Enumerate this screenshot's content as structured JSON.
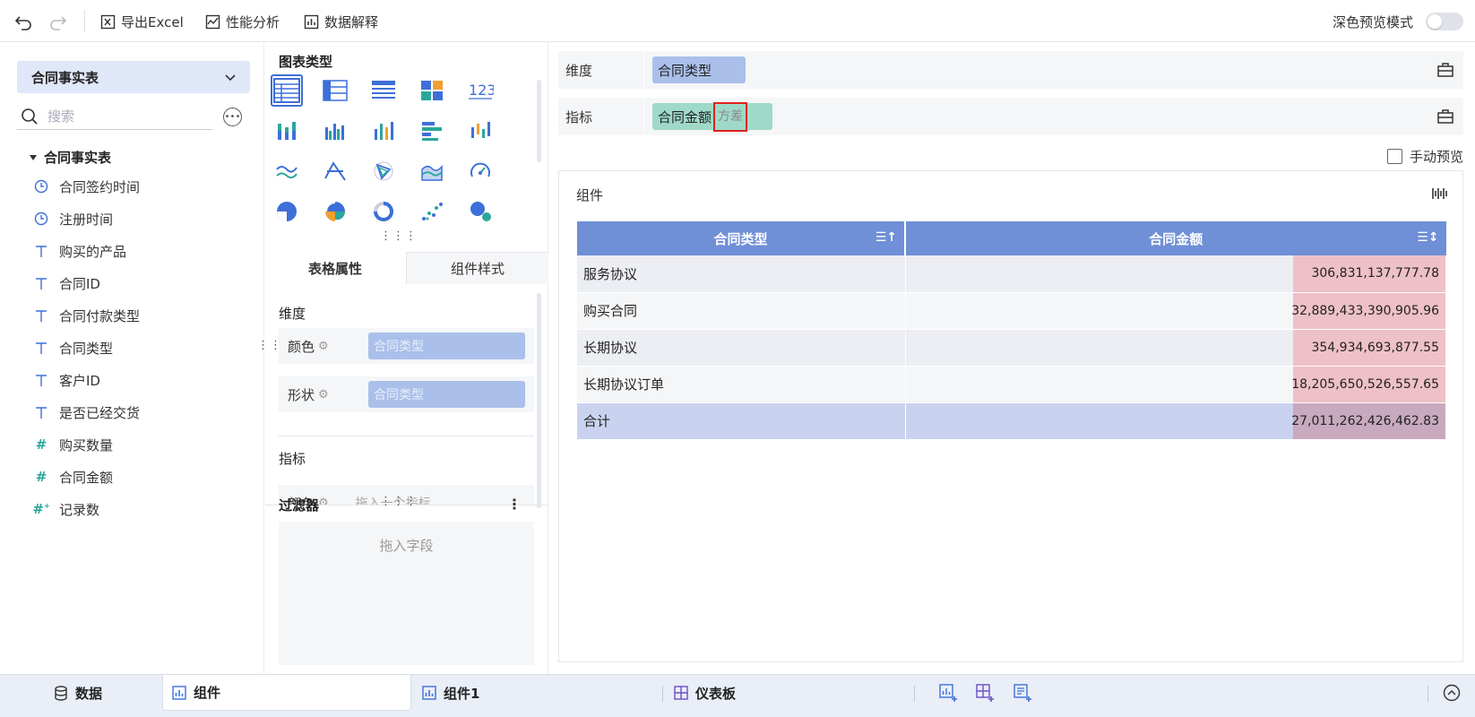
{
  "toolbar": {
    "undo": "undo",
    "redo": "redo",
    "export_excel": "导出Excel",
    "perf_analysis": "性能分析",
    "data_explain": "数据解释",
    "dark_preview": "深色预览模式",
    "dark_preview_on": false
  },
  "left": {
    "dataset": "合同事实表",
    "search_placeholder": "搜索",
    "tree_root": "合同事实表",
    "fields": [
      {
        "type": "time",
        "label": "合同签约时间"
      },
      {
        "type": "time",
        "label": "注册时间"
      },
      {
        "type": "text",
        "label": "购买的产品"
      },
      {
        "type": "text",
        "label": "合同ID"
      },
      {
        "type": "text",
        "label": "合同付款类型"
      },
      {
        "type": "text",
        "label": "合同类型"
      },
      {
        "type": "text",
        "label": "客户ID"
      },
      {
        "type": "text",
        "label": "是否已经交货"
      },
      {
        "type": "number",
        "label": "购买数量"
      },
      {
        "type": "number",
        "label": "合同金额"
      },
      {
        "type": "number-calc",
        "label": "记录数"
      }
    ]
  },
  "mid": {
    "chart_types_title": "图表类型",
    "tab_table_props": "表格属性",
    "tab_component_style": "组件样式",
    "dimension_title": "维度",
    "color_label": "颜色",
    "shape_label": "形状",
    "color_dim_value": "合同类型",
    "shape_dim_value": "合同类型",
    "metric_title": "指标",
    "metric_color_label": "颜色",
    "metric_placeholder": "拖入一个指标",
    "filter_title": "过滤器",
    "filter_placeholder": "拖入字段"
  },
  "right": {
    "dimension_label": "维度",
    "dimension_pill": "合同类型",
    "metric_label": "指标",
    "metric_pill": "合同金额",
    "metric_agg": "方差",
    "manual_preview": "手动预览",
    "component_title": "组件",
    "table": {
      "headers": [
        "合同类型",
        "合同金额"
      ],
      "rows": [
        {
          "type": "服务协议",
          "amount": "306,831,137,777.78"
        },
        {
          "type": "购买合同",
          "amount": "32,889,433,390,905.96"
        },
        {
          "type": "长期协议",
          "amount": "354,934,693,877.55"
        },
        {
          "type": "长期协议订单",
          "amount": "18,205,650,526,557.65"
        }
      ],
      "total": {
        "type": "合计",
        "amount": "27,011,262,426,462.83"
      }
    }
  },
  "bottom": {
    "data_tab": "数据",
    "component_tab": "组件",
    "component1_tab": "组件1",
    "dashboard_tab": "仪表板"
  },
  "colors": {
    "accent": "#3d6fd8",
    "header_blue": "#6f8fd6",
    "dim_pill": "#aac0ea",
    "metric_pill": "#9fdac9",
    "amount_bar": "#eec0c7",
    "highlight_box": "#e0201c"
  }
}
